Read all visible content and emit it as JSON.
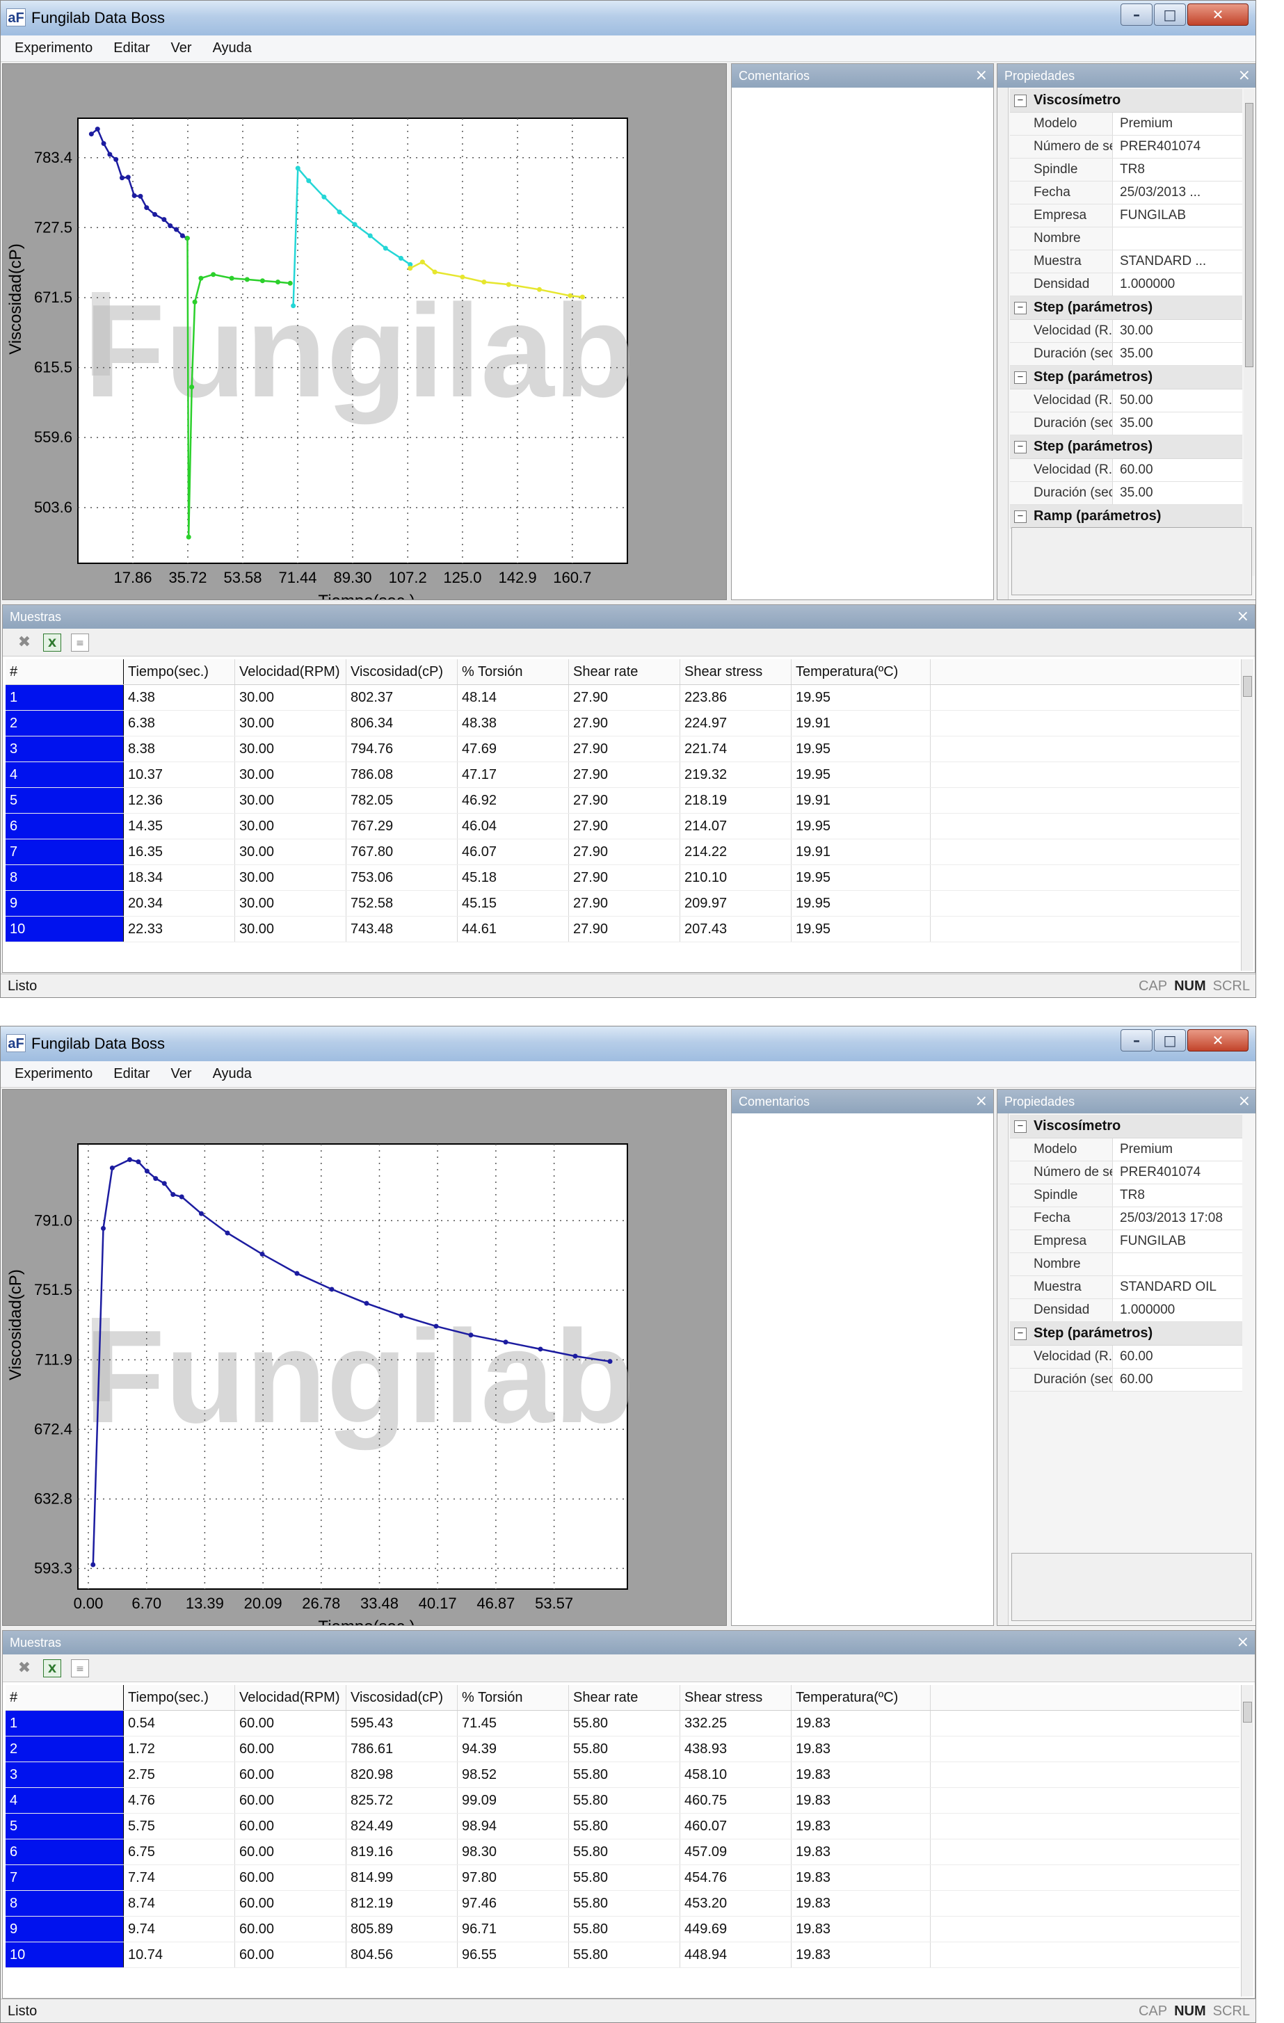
{
  "windows": [
    {
      "title": "Fungilab Data Boss",
      "icon_text": "aF",
      "menu": [
        "Experimento",
        "Editar",
        "Ver",
        "Ayuda"
      ],
      "comments_title": "Comentarios",
      "properties_title": "Propiedades",
      "properties": [
        {
          "section": "Viscosímetro",
          "rows": [
            [
              "Modelo",
              "Premium"
            ],
            [
              "Número de se...",
              "PRER401074"
            ],
            [
              "Spindle",
              "TR8"
            ],
            [
              "Fecha",
              "25/03/2013 ..."
            ],
            [
              "Empresa",
              "FUNGILAB"
            ],
            [
              "Nombre",
              ""
            ],
            [
              "Muestra",
              "STANDARD ..."
            ],
            [
              "Densidad",
              "1.000000"
            ]
          ]
        },
        {
          "section": "Step (parámetros)",
          "rows": [
            [
              "Velocidad (R...",
              "30.00"
            ],
            [
              "Duración (sec.)",
              "35.00"
            ]
          ]
        },
        {
          "section": "Step (parámetros)",
          "rows": [
            [
              "Velocidad (R...",
              "50.00"
            ],
            [
              "Duración (sec.)",
              "35.00"
            ]
          ]
        },
        {
          "section": "Step (parámetros)",
          "rows": [
            [
              "Velocidad (R...",
              "60.00"
            ],
            [
              "Duración (sec.)",
              "35.00"
            ]
          ]
        },
        {
          "section": "Ramp (parámetros)",
          "rows": []
        }
      ],
      "samples_title": "Muestras",
      "columns": [
        "#",
        "Tiempo(sec.)",
        "Velocidad(RPM)",
        "Viscosidad(cP)",
        "% Torsión",
        "Shear rate",
        "Shear stress",
        "Temperatura(ºC)"
      ],
      "rows": [
        [
          "1",
          "4.38",
          "30.00",
          "802.37",
          "48.14",
          "27.90",
          "223.86",
          "19.95"
        ],
        [
          "2",
          "6.38",
          "30.00",
          "806.34",
          "48.38",
          "27.90",
          "224.97",
          "19.91"
        ],
        [
          "3",
          "8.38",
          "30.00",
          "794.76",
          "47.69",
          "27.90",
          "221.74",
          "19.95"
        ],
        [
          "4",
          "10.37",
          "30.00",
          "786.08",
          "47.17",
          "27.90",
          "219.32",
          "19.95"
        ],
        [
          "5",
          "12.36",
          "30.00",
          "782.05",
          "46.92",
          "27.90",
          "218.19",
          "19.91"
        ],
        [
          "6",
          "14.35",
          "30.00",
          "767.29",
          "46.04",
          "27.90",
          "214.07",
          "19.95"
        ],
        [
          "7",
          "16.35",
          "30.00",
          "767.80",
          "46.07",
          "27.90",
          "214.22",
          "19.91"
        ],
        [
          "8",
          "18.34",
          "30.00",
          "753.06",
          "45.18",
          "27.90",
          "210.10",
          "19.95"
        ],
        [
          "9",
          "20.34",
          "30.00",
          "752.58",
          "45.15",
          "27.90",
          "209.97",
          "19.95"
        ],
        [
          "10",
          "22.33",
          "30.00",
          "743.48",
          "44.61",
          "27.90",
          "207.43",
          "19.95"
        ]
      ],
      "status": "Listo",
      "indicators": [
        "CAP",
        "NUM",
        "SCRL"
      ]
    },
    {
      "title": "Fungilab Data Boss",
      "icon_text": "aF",
      "menu": [
        "Experimento",
        "Editar",
        "Ver",
        "Ayuda"
      ],
      "comments_title": "Comentarios",
      "properties_title": "Propiedades",
      "properties": [
        {
          "section": "Viscosímetro",
          "rows": [
            [
              "Modelo",
              "Premium"
            ],
            [
              "Número de se...",
              "PRER401074"
            ],
            [
              "Spindle",
              "TR8"
            ],
            [
              "Fecha",
              "25/03/2013 17:08"
            ],
            [
              "Empresa",
              "FUNGILAB"
            ],
            [
              "Nombre",
              ""
            ],
            [
              "Muestra",
              "STANDARD OIL"
            ],
            [
              "Densidad",
              "1.000000"
            ]
          ]
        },
        {
          "section": "Step (parámetros)",
          "rows": [
            [
              "Velocidad (R...",
              "60.00"
            ],
            [
              "Duración (sec.)",
              "60.00"
            ]
          ]
        }
      ],
      "samples_title": "Muestras",
      "columns": [
        "#",
        "Tiempo(sec.)",
        "Velocidad(RPM)",
        "Viscosidad(cP)",
        "% Torsión",
        "Shear rate",
        "Shear stress",
        "Temperatura(ºC)"
      ],
      "rows": [
        [
          "1",
          "0.54",
          "60.00",
          "595.43",
          "71.45",
          "55.80",
          "332.25",
          "19.83"
        ],
        [
          "2",
          "1.72",
          "60.00",
          "786.61",
          "94.39",
          "55.80",
          "438.93",
          "19.83"
        ],
        [
          "3",
          "2.75",
          "60.00",
          "820.98",
          "98.52",
          "55.80",
          "458.10",
          "19.83"
        ],
        [
          "4",
          "4.76",
          "60.00",
          "825.72",
          "99.09",
          "55.80",
          "460.75",
          "19.83"
        ],
        [
          "5",
          "5.75",
          "60.00",
          "824.49",
          "98.94",
          "55.80",
          "460.07",
          "19.83"
        ],
        [
          "6",
          "6.75",
          "60.00",
          "819.16",
          "98.30",
          "55.80",
          "457.09",
          "19.83"
        ],
        [
          "7",
          "7.74",
          "60.00",
          "814.99",
          "97.80",
          "55.80",
          "454.76",
          "19.83"
        ],
        [
          "8",
          "8.74",
          "60.00",
          "812.19",
          "97.46",
          "55.80",
          "453.20",
          "19.83"
        ],
        [
          "9",
          "9.74",
          "60.00",
          "805.89",
          "96.71",
          "55.80",
          "449.69",
          "19.83"
        ],
        [
          "10",
          "10.74",
          "60.00",
          "804.56",
          "96.55",
          "55.80",
          "448.94",
          "19.83"
        ]
      ],
      "status": "Listo",
      "indicators": [
        "CAP",
        "NUM",
        "SCRL"
      ]
    }
  ],
  "chart_data": [
    {
      "type": "line",
      "xlabel": "Tiempo(sec.)",
      "ylabel": "Viscosidad(cP)",
      "xticks": [
        "17.86",
        "35.72",
        "53.58",
        "71.44",
        "89.30",
        "107.2",
        "125.0",
        "142.9",
        "160.7"
      ],
      "yticks": [
        "783.4",
        "727.5",
        "671.5",
        "615.5",
        "559.6",
        "503.6"
      ],
      "xlim": [
        0,
        178.6
      ],
      "ylim": [
        459,
        815
      ],
      "grid": true,
      "watermark": "Fungilab",
      "series": [
        {
          "color": "#1c1ca0",
          "points": [
            [
              4.38,
              802.37
            ],
            [
              6.38,
              806.34
            ],
            [
              8.38,
              794.76
            ],
            [
              10.37,
              786.08
            ],
            [
              12.36,
              782.05
            ],
            [
              14.35,
              767.29
            ],
            [
              16.35,
              767.8
            ],
            [
              18.34,
              753.06
            ],
            [
              20.34,
              752.58
            ],
            [
              22.33,
              743.48
            ],
            [
              25,
              738
            ],
            [
              28,
              734
            ],
            [
              30,
              729
            ],
            [
              32,
              726
            ],
            [
              34,
              721
            ],
            [
              35.5,
              719
            ]
          ]
        },
        {
          "color": "#2bd02b",
          "points": [
            [
              35.6,
              719
            ],
            [
              36,
              480
            ],
            [
              37,
              600
            ],
            [
              38,
              668
            ],
            [
              40,
              687
            ],
            [
              44,
              690
            ],
            [
              50,
              687
            ],
            [
              55,
              686
            ],
            [
              60,
              685
            ],
            [
              65,
              684
            ],
            [
              69,
              683
            ]
          ]
        },
        {
          "color": "#24d6d6",
          "points": [
            [
              70,
              665
            ],
            [
              71.5,
              775
            ],
            [
              75,
              765
            ],
            [
              80,
              752
            ],
            [
              85,
              740
            ],
            [
              90,
              730
            ],
            [
              95,
              721
            ],
            [
              100,
              711
            ],
            [
              105,
              703
            ],
            [
              108,
              698
            ]
          ]
        },
        {
          "color": "#e6e62e",
          "points": [
            [
              108,
              695
            ],
            [
              112,
              700
            ],
            [
              116,
              692
            ],
            [
              125,
              688
            ],
            [
              132,
              684
            ],
            [
              140,
              682
            ],
            [
              150,
              678
            ],
            [
              160,
              673
            ],
            [
              164,
              672
            ]
          ]
        }
      ]
    },
    {
      "type": "line",
      "xlabel": "Tiempo(sec.)",
      "ylabel": "Viscosidad(cP)",
      "xticks": [
        "0.00",
        "6.70",
        "13.39",
        "20.09",
        "26.78",
        "33.48",
        "40.17",
        "46.87",
        "53.57"
      ],
      "yticks": [
        "791.0",
        "751.5",
        "711.9",
        "672.4",
        "632.8",
        "593.3"
      ],
      "xlim": [
        -1.2,
        62.0
      ],
      "ylim": [
        581.6,
        834.6
      ],
      "grid": true,
      "watermark": "Fungilab",
      "series": [
        {
          "color": "#1c1ca0",
          "points": [
            [
              0.54,
              595.43
            ],
            [
              1.72,
              786.61
            ],
            [
              2.75,
              820.98
            ],
            [
              4.76,
              825.72
            ],
            [
              5.75,
              824.49
            ],
            [
              6.75,
              819.16
            ],
            [
              7.74,
              814.99
            ],
            [
              8.74,
              812.19
            ],
            [
              9.74,
              805.89
            ],
            [
              10.74,
              804.56
            ],
            [
              13,
              795
            ],
            [
              16,
              784
            ],
            [
              20,
              772
            ],
            [
              24,
              761
            ],
            [
              28,
              752
            ],
            [
              32,
              744
            ],
            [
              36,
              737
            ],
            [
              40,
              731
            ],
            [
              44,
              726
            ],
            [
              48,
              722
            ],
            [
              52,
              718
            ],
            [
              56,
              714
            ],
            [
              60,
              711
            ]
          ]
        }
      ]
    }
  ]
}
